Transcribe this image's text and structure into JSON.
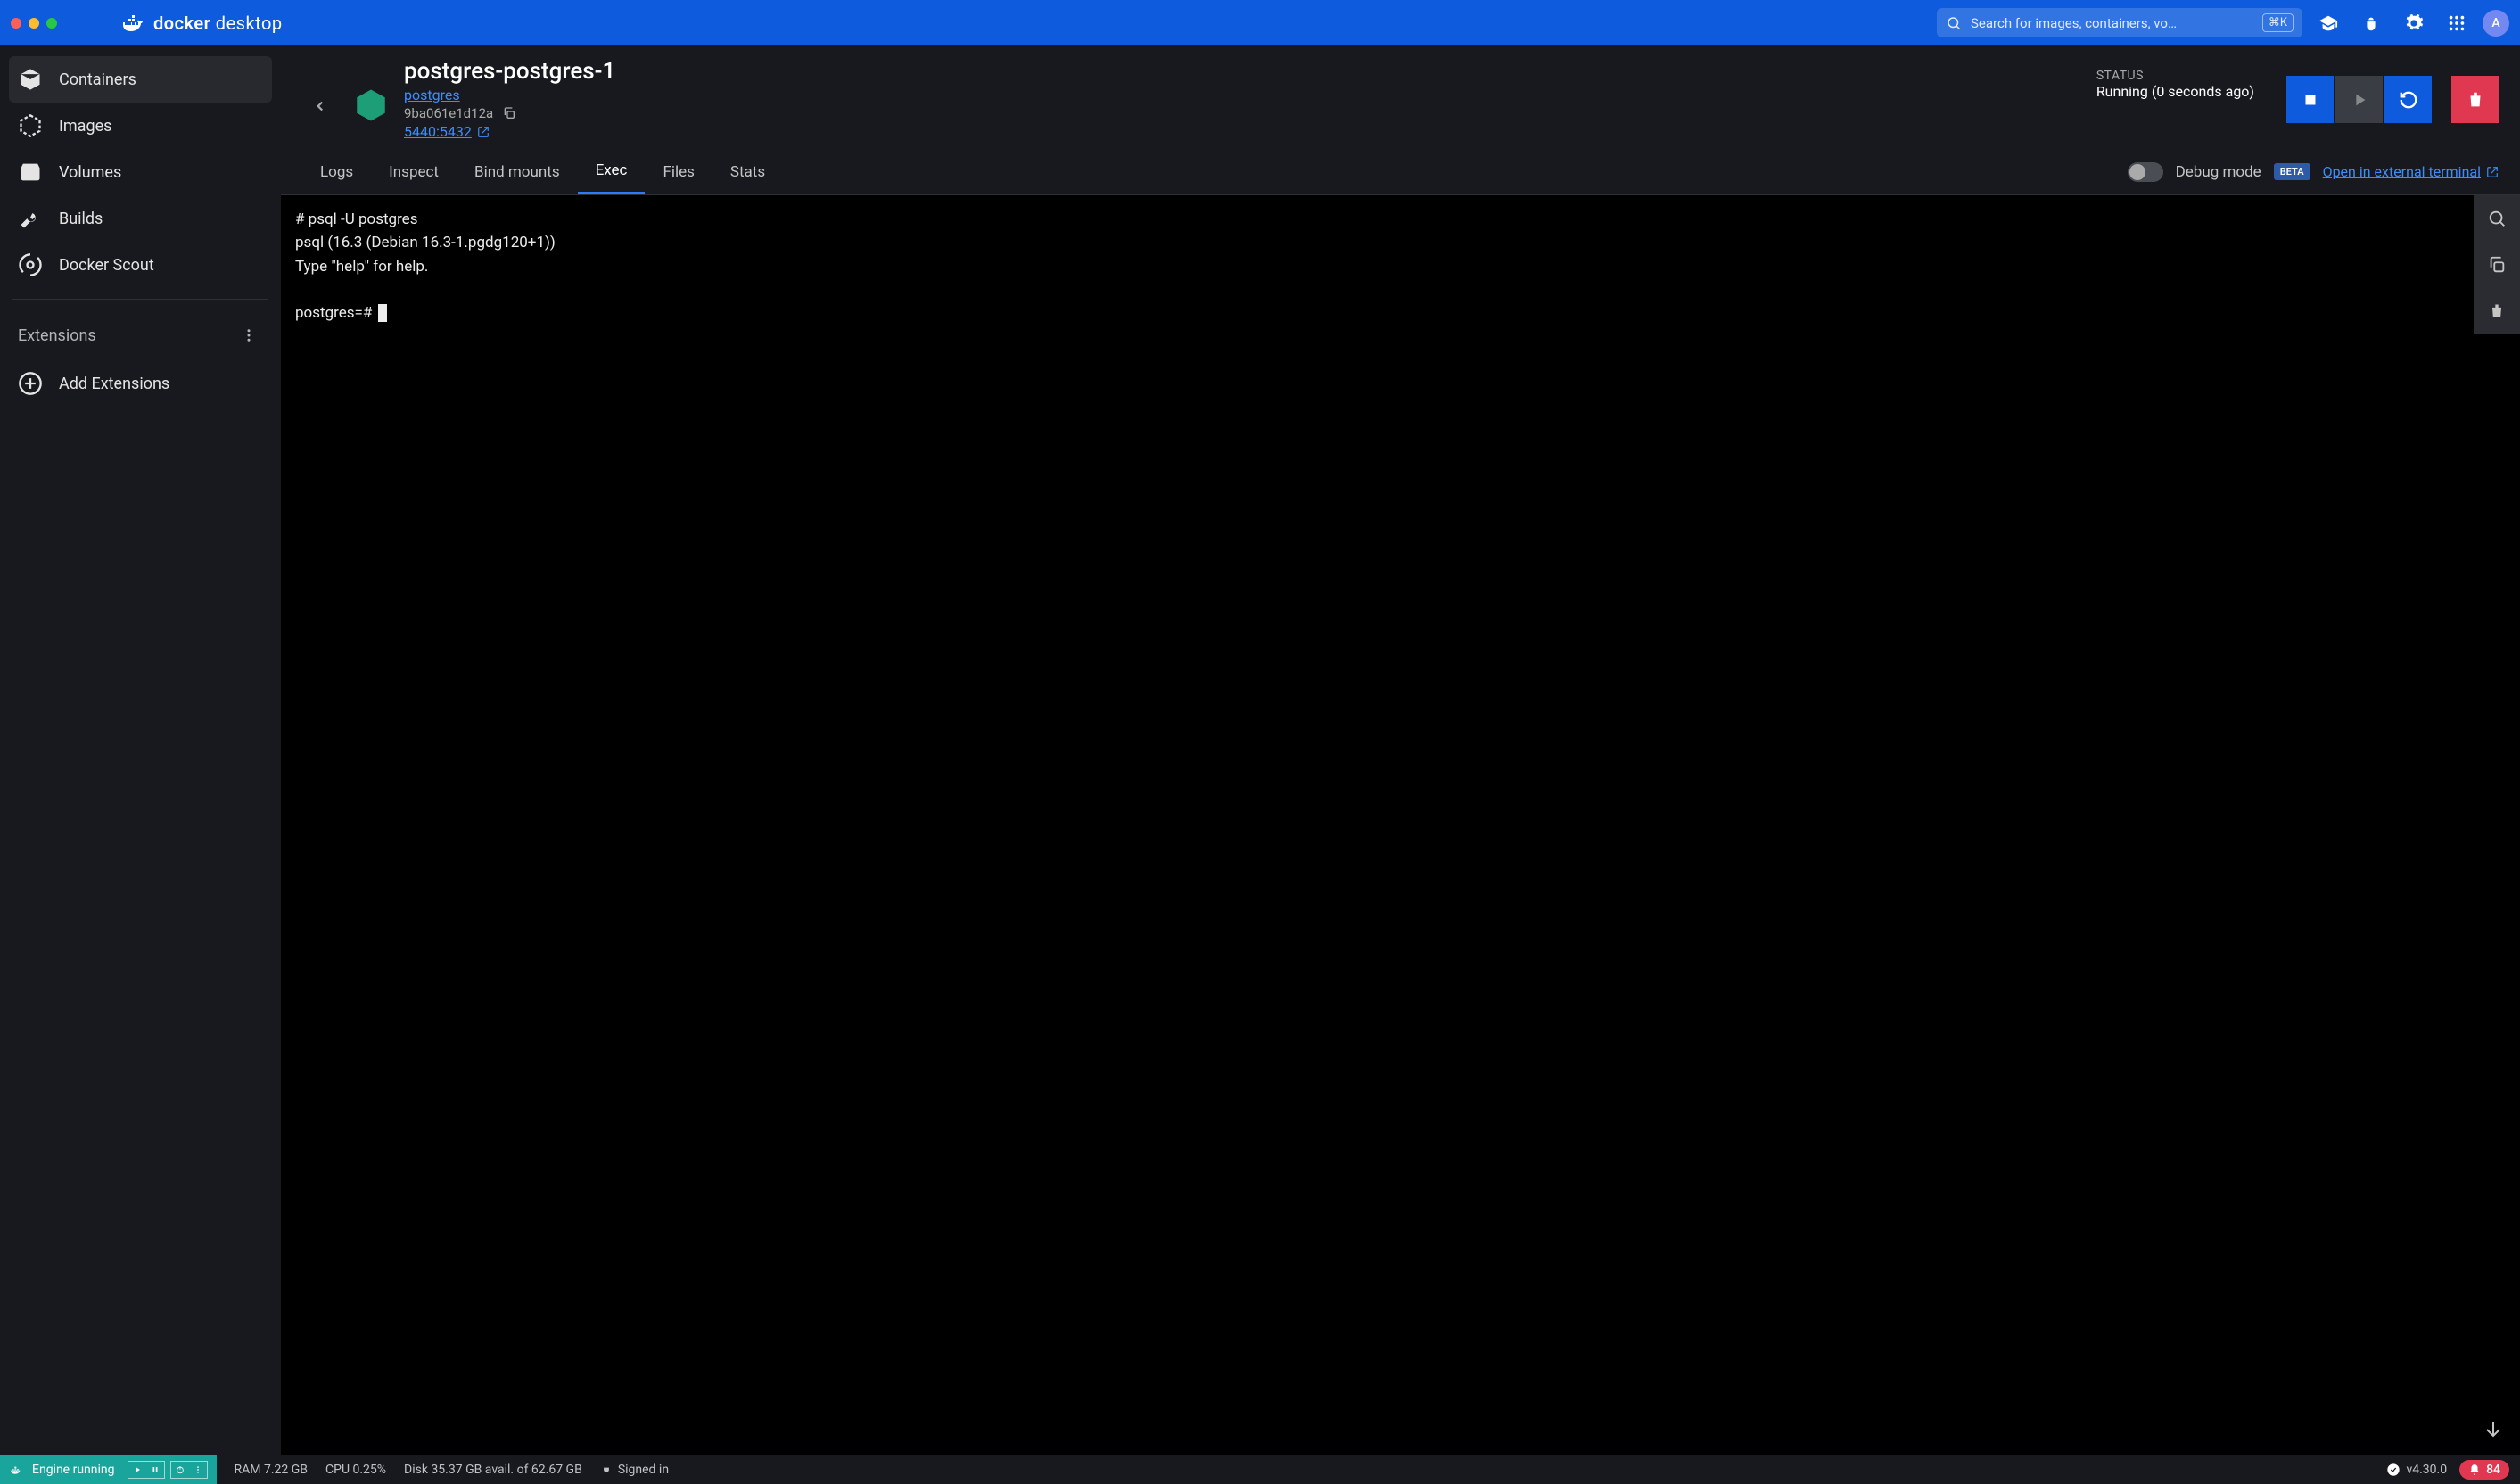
{
  "titlebar": {
    "brand_bold": "docker",
    "brand_light": "desktop",
    "search_placeholder": "Search for images, containers, vo…",
    "search_shortcut": "⌘K",
    "avatar_initial": "A"
  },
  "sidebar": {
    "items": [
      {
        "label": "Containers"
      },
      {
        "label": "Images"
      },
      {
        "label": "Volumes"
      },
      {
        "label": "Builds"
      },
      {
        "label": "Docker Scout"
      }
    ],
    "extensions_label": "Extensions",
    "add_extensions_label": "Add Extensions"
  },
  "container": {
    "name": "postgres-postgres-1",
    "image_link": "postgres",
    "hash": "9ba061e1d12a",
    "port_mapping": "5440:5432",
    "status_label": "STATUS",
    "status_value": "Running (0 seconds ago)"
  },
  "tabs": [
    {
      "label": "Logs"
    },
    {
      "label": "Inspect"
    },
    {
      "label": "Bind mounts"
    },
    {
      "label": "Exec"
    },
    {
      "label": "Files"
    },
    {
      "label": "Stats"
    }
  ],
  "debug": {
    "label": "Debug mode",
    "beta": "BETA",
    "open_external": "Open in external terminal"
  },
  "terminal": {
    "line1": "# psql -U postgres",
    "line2": "psql (16.3 (Debian 16.3-1.pgdg120+1))",
    "line3": "Type \"help\" for help.",
    "prompt": "postgres=# "
  },
  "statusbar": {
    "engine": "Engine running",
    "ram": "RAM 7.22 GB",
    "cpu": "CPU 0.25%",
    "disk": "Disk 35.37 GB avail. of 62.67 GB",
    "signed_in": "Signed in",
    "version": "v4.30.0",
    "notifications": "84"
  }
}
